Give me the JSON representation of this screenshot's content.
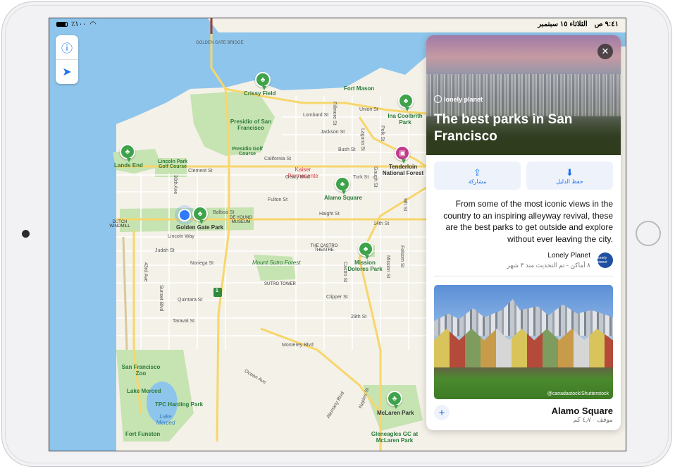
{
  "statusbar": {
    "time": "٩:٤١ ص",
    "date": "الثلاثاء ١٥ سبتمبر",
    "battery": "٪١٠٠"
  },
  "map_controls": {
    "info_icon": "info-icon",
    "location_icon": "location-arrow-icon"
  },
  "map": {
    "bridge_label": "GOLDEN GATE BRIDGE",
    "pois": {
      "crissy": "Crissy Field",
      "fort_mason": "Fort Mason",
      "presidio": "Presidio of San Francisco",
      "presidio_golf": "Presidio Golf Course",
      "ina": "Ina Coolbrith Park",
      "lands_end": "Lands End",
      "lincoln_golf": "Lincoln Park Golf Course",
      "tenderloin": "Tenderloin National Forest",
      "kaiser": "Kaiser Permanente",
      "alamo": "Alamo Square",
      "dutch": "DUTCH WINDMILL",
      "golden_gate_park": "Golden Gate Park",
      "de_young": "DE YOUNG MUSEUM",
      "castro": "THE CASTRO THEATRE",
      "mission": "Mission Dolores Park",
      "sutro_forest": "Mount Sutro Forest",
      "sutro_tower": "SUTRO TOWER",
      "sf_zoo": "San Francisco Zoo",
      "lake_merced": "Lake Merced",
      "tpc": "TPC Harding Park",
      "lake_merced_small": "Lake Merced",
      "fort_funston": "Fort Funston",
      "mclaren": "McLaren Park",
      "gleneagles": "Gleneagles GC at McLaren Park"
    },
    "streets": {
      "lombard": "Lombard St",
      "union": "Union St",
      "fillmore": "Fillmore St",
      "jackson": "Jackson St",
      "bush": "Bush St",
      "california": "California St",
      "clement": "Clement St",
      "geary": "Geary Blvd",
      "laguna": "Laguna St",
      "turk": "Turk St",
      "polk": "Polk St",
      "balboa": "Balboa St",
      "fulton": "Fulton St",
      "gough": "Gough St",
      "haight": "Haight St",
      "lincoln": "Lincoln Way",
      "judah": "Judah St",
      "fourteenth": "14th St",
      "ninth": "9th St",
      "thirtieth_ave": "30th Ave",
      "castro": "Castro St",
      "folsom": "Folsom St",
      "mission": "Mission St",
      "noriega": "Noriega St",
      "fortythird": "43rd Ave",
      "sunset": "Sunset Blvd",
      "quintara": "Quintara St",
      "taraval": "Taraval St",
      "clipper": "Clipper St",
      "twentyninth": "29th St",
      "monterey": "Monterey Blvd",
      "ocean": "Ocean Ave",
      "alemany": "Alemany Blvd",
      "naples": "Naples St",
      "highway": "1"
    }
  },
  "guide": {
    "close_icon": "close-icon",
    "logo_text": "lonely planet",
    "title": "The best parks in San Francisco",
    "share_label": "مشاركة",
    "save_label": "حفظ الدليل",
    "description": "From some of the most iconic views in the country to an inspiring alleyway revival, these are the best parks to get outside and explore without ever leaving the city.",
    "author": "Lonely Planet",
    "author_meta": "٨ أماكن - تم التحديث منذ ٣ شهر",
    "avatar_text": "lonely planet",
    "photo_credit": "@canadastock/Shutterstock",
    "place_name": "Alamo Square",
    "place_meta": "موقف · ٤٫٧ كم",
    "add_icon": "plus-icon"
  },
  "colors": {
    "water": "#8ec5ec",
    "park": "#c6e3b2",
    "road": "#f7d66b",
    "pin": "#3ea34a",
    "accent": "#1a73e8"
  }
}
